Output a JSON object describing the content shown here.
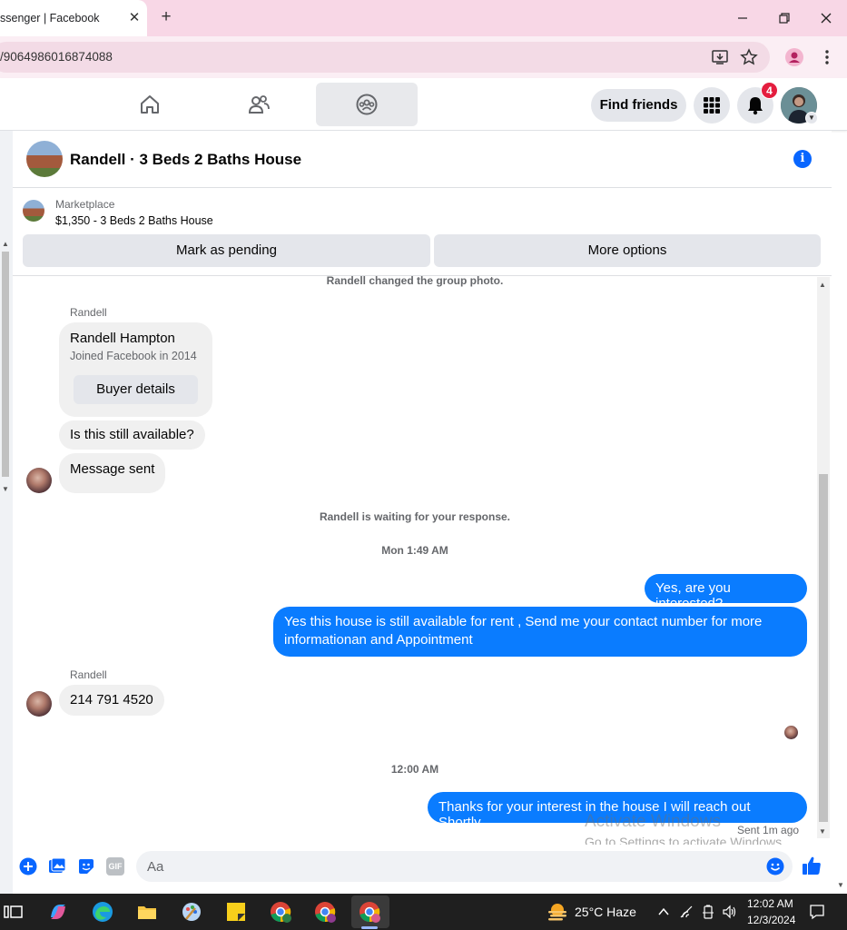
{
  "browser": {
    "tab_title": "ssenger | Facebook",
    "tab_close": "✕",
    "new_tab": "+",
    "url": "/9064986016874088"
  },
  "fb_nav": {
    "find_friends": "Find friends",
    "notification_count": "4"
  },
  "conversation": {
    "title": "Randell · 3 Beds 2 Baths House",
    "info_icon": "i",
    "marketplace_label": "Marketplace",
    "listing": "$1,350 - 3 Beds 2 Baths House",
    "mark_pending": "Mark as pending",
    "more_options": "More options"
  },
  "messages": {
    "group_photo_notice": "Randell changed the group photo.",
    "sender_1": "Randell",
    "card_name": "Randell Hampton",
    "card_sub": "Joined Facebook in 2014",
    "buyer_details": "Buyer details",
    "msg_available": "Is this still available?",
    "msg_sent": "Message sent",
    "waiting_notice": "Randell is waiting for your response.",
    "time_1": "Mon 1:49 AM",
    "out_1": "Yes, are you interested?",
    "out_2": "Yes this house is still available for rent , Send me your contact number for more informationan and Appointment",
    "sender_2": "Randell",
    "in_phone": "214 791 4520",
    "time_2": "12:00 AM",
    "out_3": "Thanks for your interest in the house I will reach out Shortly",
    "sent_status": "Sent 1m ago"
  },
  "watermark": {
    "line1": "Activate Windows",
    "line2": "Go to Settings to activate Windows."
  },
  "composer": {
    "placeholder": "Aa",
    "gif_label": "GIF"
  },
  "taskbar": {
    "weather": "25°C  Haze",
    "time": "12:02 AM",
    "date": "12/3/2024"
  },
  "colors": {
    "accent": "#0a7cff",
    "fb_blue": "#0866ff",
    "badge_red": "#e41e3f",
    "tab_strip": "#f8d7e6"
  }
}
